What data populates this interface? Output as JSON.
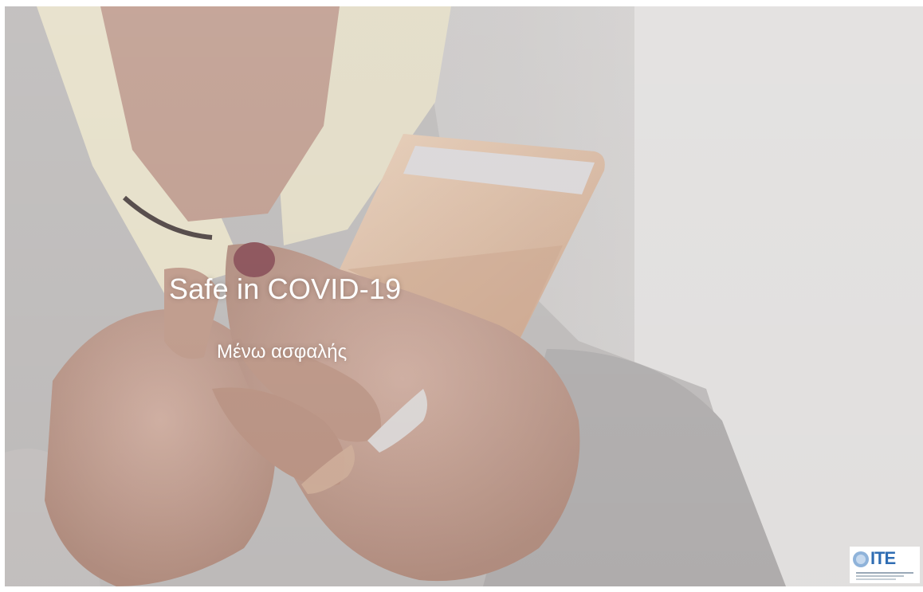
{
  "slide": {
    "title": "Safe in COVID-19",
    "subtitle": "Μένω ασφαλής",
    "background_description_icon": "elderly-hands-smartphone-photo"
  },
  "logo": {
    "text": "ITE",
    "icon": "ite-logo-icon",
    "color": "#2f6db3"
  }
}
